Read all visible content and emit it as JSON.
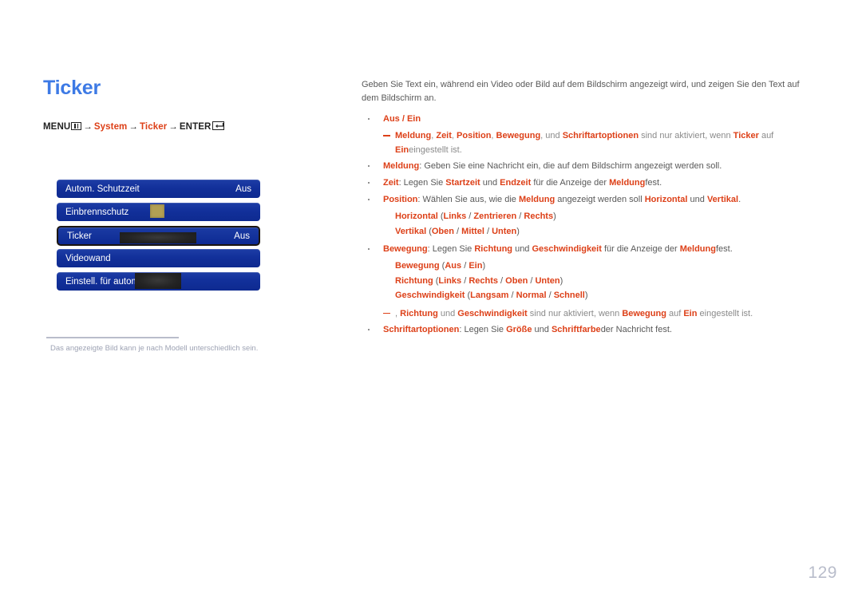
{
  "page": {
    "title": "Ticker",
    "number": "129",
    "title_color": "#3d7ae5",
    "accent_color": "#dd4018",
    "menu_blue": "#12309a"
  },
  "breadcrumb": {
    "menu_label": "MENU",
    "menu_icon": "menu-bars-icon",
    "arrow": "→",
    "step1": "System",
    "step2": "Ticker",
    "enter_label": "ENTER",
    "enter_icon": "enter-return-icon"
  },
  "osd_menu": {
    "rows": [
      {
        "label": "Autom. Schutzzeit",
        "value": "Aus",
        "selected": false
      },
      {
        "label": "Einbrennschutz",
        "value": "",
        "selected": false
      },
      {
        "label": "Ticker",
        "value": "Aus",
        "selected": true
      },
      {
        "label": "Videowand",
        "value": "",
        "selected": false
      },
      {
        "label": "Einstell. für autom. Quelle",
        "value": "",
        "selected": false
      }
    ]
  },
  "caption": {
    "text": "Das angezeigte Bild kann je nach Modell unterschiedlich sein."
  },
  "body": {
    "intro": "Geben Sie Text ein, während ein Video oder Bild auf dem Bildschirm angezeigt wird, und zeigen Sie den Text auf dem Bildschirm an.",
    "items": [
      {
        "id": "aus-ein",
        "head": "Aus / Ein"
      },
      {
        "id": "note-1",
        "text": "Meldung, Zeit, Position, Bewegung, und Schriftartoptionen sind nur aktiviert, wenn Ticker auf Ein eingestellt ist."
      },
      {
        "id": "meldung",
        "text": "Meldung: Geben Sie eine Nachricht ein, die auf dem Bildschirm angezeigt werden soll."
      },
      {
        "id": "zeit",
        "text": "Zeit: Legen Sie Startzeit und Endzeit für die Anzeige der Meldung fest."
      },
      {
        "id": "position",
        "text": "Position: Wählen Sie aus, wie die Meldung angezeigt werden soll Horizontal und Vertikal."
      },
      {
        "id": "position-horizontal",
        "text": "Horizontal (Links / Zentrieren / Rechts)"
      },
      {
        "id": "position-vertikal",
        "text": "Vertikal (Oben / Mittel / Unten)"
      },
      {
        "id": "bewegung",
        "text": "Bewegung: Legen Sie Richtung und Geschwindigkeit für die Anzeige der Meldung fest."
      },
      {
        "id": "bewegung-opt",
        "text": "Bewegung (Aus / Ein)"
      },
      {
        "id": "richtung-opt",
        "text": "Richtung (Links / Rechts / Oben / Unten)"
      },
      {
        "id": "geschwindigkeit-opt",
        "text": "Geschwindigkeit (Langsam / Normal / Schnell)"
      },
      {
        "id": "note-2",
        "text": "Richtung und Geschwindigkeit sind nur aktiviert, wenn Bewegung auf Ein eingestellt ist."
      },
      {
        "id": "schriftart",
        "text": "Schriftartoptionen: Legen Sie Größe und Schriftfarbe der Nachricht fest."
      }
    ],
    "tokens": {
      "meldung": "Meldung",
      "zeit": "Zeit",
      "position": "Position",
      "bewegung": "Bewegung",
      "schriftartoptionen": "Schriftartoptionen",
      "ticker": "Ticker",
      "ein": "Ein",
      "aus": "Aus",
      "startzeit": "Startzeit",
      "endzeit": "Endzeit",
      "horizontal": "Horizontal",
      "vertikal": "Vertikal",
      "links": "Links",
      "zentrieren": "Zentrieren",
      "rechts": "Rechts",
      "oben": "Oben",
      "mittel": "Mittel",
      "unten": "Unten",
      "richtung": "Richtung",
      "geschwindigkeit": "Geschwindigkeit",
      "langsam": "Langsam",
      "normal": "Normal",
      "schnell": "Schnell",
      "groesse": "Größe",
      "schriftfarbe": "Schriftfarbe"
    },
    "fragments": {
      "aus_ein_sep": " / ",
      "note1_tail_a": ", und ",
      "note1_tail_b": " sind nur aktiviert, wenn ",
      "note1_tail_c": " auf ",
      "note1_tail_d": "eingestellt ist.",
      "meldung_tail": ": Geben Sie eine Nachricht ein, die auf dem Bildschirm angezeigt werden soll.",
      "zeit_mid1": ": Legen Sie ",
      "zeit_mid2": " und ",
      "zeit_mid3": " für die Anzeige der ",
      "zeit_tail": "fest.",
      "position_mid1": ": Wählen Sie aus, wie die ",
      "position_mid2": " angezeigt werden soll ",
      "position_mid3": " und ",
      "position_tail": ".",
      "bewegung_mid1": ": Legen Sie ",
      "bewegung_mid2": " und ",
      "bewegung_mid3": " für die Anzeige der ",
      "bewegung_tail": "fest.",
      "note2_lead": ", ",
      "note2_mid1": " und ",
      "note2_mid2": " sind nur aktiviert, wenn ",
      "note2_mid3": " auf ",
      "note2_tail": " eingestellt ist.",
      "schrift_mid1": ": Legen Sie ",
      "schrift_mid2": " und ",
      "schrift_tail": "der Nachricht fest.",
      "paren_open": " (",
      "paren_close": ")",
      "slash": " / ",
      "comma": ", "
    }
  }
}
